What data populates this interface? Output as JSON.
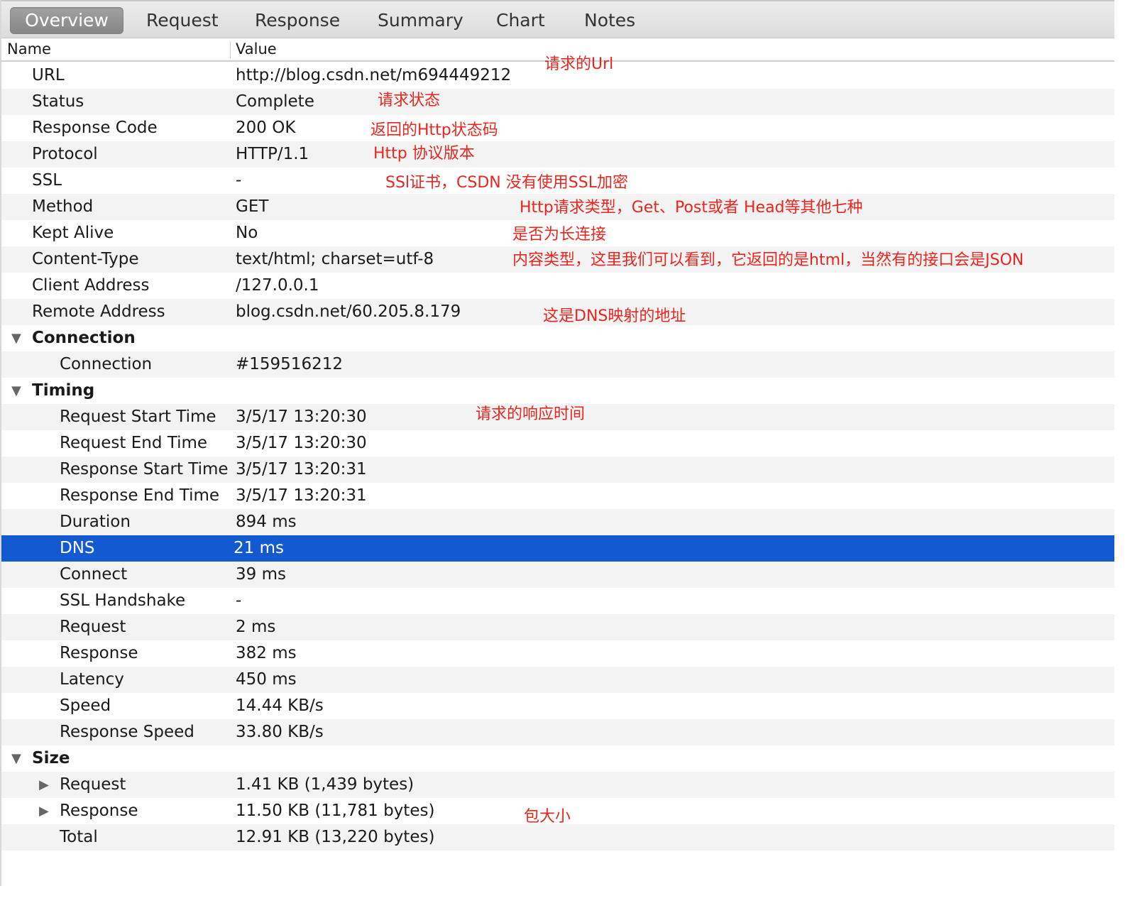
{
  "tabs": [
    {
      "label": "Overview",
      "active": true
    },
    {
      "label": "Request",
      "active": false
    },
    {
      "label": "Response",
      "active": false
    },
    {
      "label": "Summary",
      "active": false
    },
    {
      "label": "Chart",
      "active": false
    },
    {
      "label": "Notes",
      "active": false
    }
  ],
  "columns": {
    "name": "Name",
    "value": "Value"
  },
  "rows": [
    {
      "name": "URL",
      "value": "http://blog.csdn.net/m694449212",
      "level": 0
    },
    {
      "name": "Status",
      "value": "Complete",
      "level": 0
    },
    {
      "name": "Response Code",
      "value": "200 OK",
      "level": 0
    },
    {
      "name": "Protocol",
      "value": "HTTP/1.1",
      "level": 0
    },
    {
      "name": "SSL",
      "value": "-",
      "level": 0
    },
    {
      "name": "Method",
      "value": "GET",
      "level": 0
    },
    {
      "name": "Kept Alive",
      "value": "No",
      "level": 0
    },
    {
      "name": "Content-Type",
      "value": "text/html; charset=utf-8",
      "level": 0
    },
    {
      "name": "Client Address",
      "value": "/127.0.0.1",
      "level": 0
    },
    {
      "name": "Remote Address",
      "value": "blog.csdn.net/60.205.8.179",
      "level": 0
    },
    {
      "name": "Connection",
      "value": "",
      "level": 0,
      "group": true,
      "expanded": true
    },
    {
      "name": "Connection",
      "value": "#159516212",
      "level": 1
    },
    {
      "name": "Timing",
      "value": "",
      "level": 0,
      "group": true,
      "expanded": true
    },
    {
      "name": "Request Start Time",
      "value": "3/5/17 13:20:30",
      "level": 1
    },
    {
      "name": "Request End Time",
      "value": "3/5/17 13:20:30",
      "level": 1
    },
    {
      "name": "Response Start Time",
      "value": "3/5/17 13:20:31",
      "level": 1
    },
    {
      "name": "Response End Time",
      "value": "3/5/17 13:20:31",
      "level": 1
    },
    {
      "name": "Duration",
      "value": "894 ms",
      "level": 1
    },
    {
      "name": "DNS",
      "value": "21 ms",
      "level": 1,
      "selected": true
    },
    {
      "name": "Connect",
      "value": "39 ms",
      "level": 1
    },
    {
      "name": "SSL Handshake",
      "value": "-",
      "level": 1
    },
    {
      "name": "Request",
      "value": "2 ms",
      "level": 1
    },
    {
      "name": "Response",
      "value": "382 ms",
      "level": 1
    },
    {
      "name": "Latency",
      "value": "450 ms",
      "level": 1
    },
    {
      "name": "Speed",
      "value": "14.44 KB/s",
      "level": 1
    },
    {
      "name": "Response Speed",
      "value": "33.80 KB/s",
      "level": 1
    },
    {
      "name": "Size",
      "value": "",
      "level": 0,
      "group": true,
      "expanded": true
    },
    {
      "name": "Request",
      "value": "1.41 KB (1,439 bytes)",
      "level": 1,
      "collapsible": true
    },
    {
      "name": "Response",
      "value": "11.50 KB (11,781 bytes)",
      "level": 1,
      "collapsible": true
    },
    {
      "name": "Total",
      "value": "12.91 KB (13,220 bytes)",
      "level": 1
    },
    {
      "name": "",
      "value": "",
      "level": 0
    }
  ],
  "annotations": [
    {
      "text": "请求的Url"
    },
    {
      "text": "请求状态"
    },
    {
      "text": "返回的Http状态码"
    },
    {
      "text": "Http 协议版本"
    },
    {
      "text": "SSl证书，CSDN 没有使用SSL加密"
    },
    {
      "text": "Http请求类型，Get、Post或者 Head等其他七种"
    },
    {
      "text": "是否为长连接"
    },
    {
      "text": "内容类型，这里我们可以看到，它返回的是html，当然有的接口会是JSON"
    },
    {
      "text": "这是DNS映射的地址"
    },
    {
      "text": "请求的响应时间"
    },
    {
      "text": "包大小"
    }
  ],
  "colors": {
    "selected": "#1359cf",
    "annotation": "#e8261f",
    "tab_active": "#8e8e8e"
  }
}
